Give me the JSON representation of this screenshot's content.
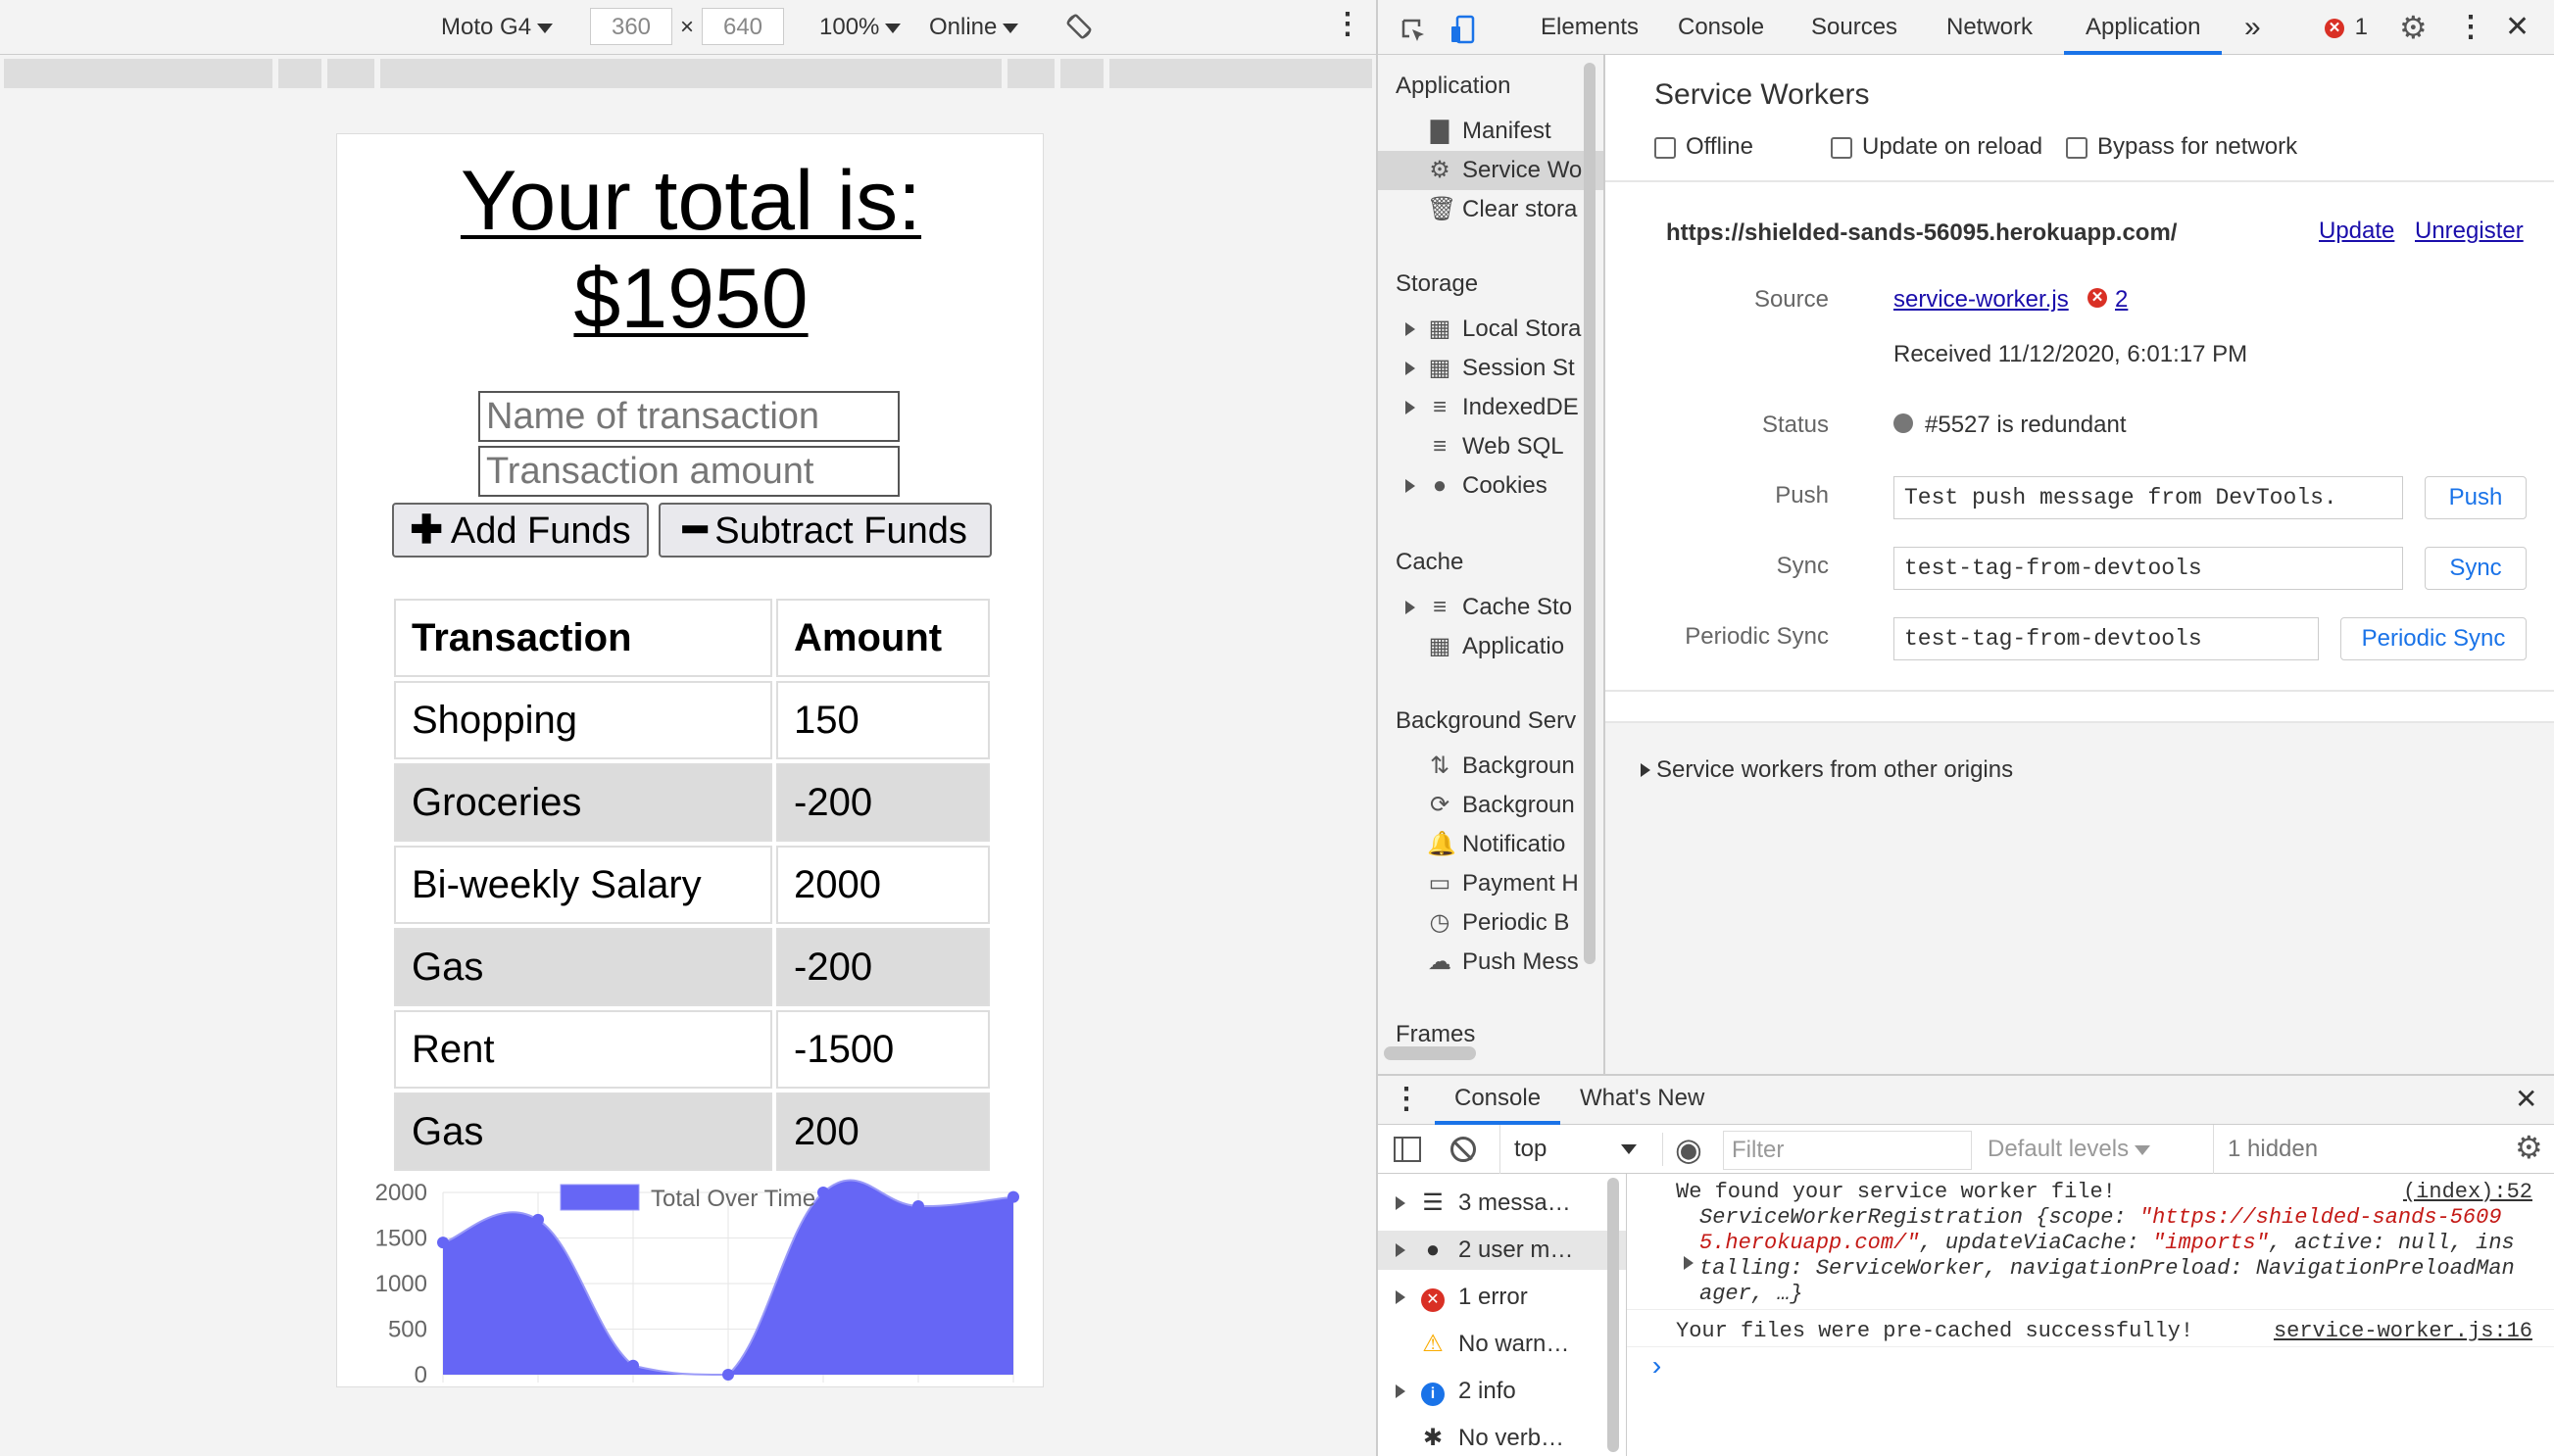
{
  "device_toolbar": {
    "device": "Moto G4",
    "width": "360",
    "height": "640",
    "times": "×",
    "zoom": "100%",
    "network": "Online"
  },
  "app": {
    "total_line1": "Your total is:",
    "total_line2": "$1950",
    "name_placeholder": "Name of transaction",
    "amount_placeholder": "Transaction amount",
    "add_label": "Add Funds",
    "subtract_label": "Subtract Funds",
    "table_headers": [
      "Transaction",
      "Amount"
    ],
    "rows": [
      {
        "name": "Shopping",
        "amount": "150"
      },
      {
        "name": "Groceries",
        "amount": "-200"
      },
      {
        "name": "Bi-weekly Salary",
        "amount": "2000"
      },
      {
        "name": "Gas",
        "amount": "-200"
      },
      {
        "name": "Rent",
        "amount": "-1500"
      },
      {
        "name": "Gas",
        "amount": "200"
      }
    ]
  },
  "chart_data": {
    "type": "area",
    "title": "",
    "series": [
      {
        "name": "Total Over Time",
        "values": [
          1450,
          1700,
          100,
          0,
          2000,
          1850,
          1950
        ],
        "color": "#6666f5"
      }
    ],
    "ylim": [
      0,
      2000
    ],
    "yticks": [
      "2000",
      "1500",
      "1000",
      "500",
      "0"
    ],
    "grid": true,
    "legend": "top"
  },
  "devtools": {
    "tabs": [
      "Elements",
      "Console",
      "Sources",
      "Network",
      "Application"
    ],
    "active_tab": "Application",
    "more": "»",
    "error_count": "1",
    "sidebar": {
      "application_header": "Application",
      "application_items": [
        "Manifest",
        "Service Wo",
        "Clear stora"
      ],
      "storage_header": "Storage",
      "storage_items": [
        "Local Stora",
        "Session St",
        "IndexedDE",
        "Web SQL",
        "Cookies"
      ],
      "cache_header": "Cache",
      "cache_items": [
        "Cache Sto",
        "Applicatio"
      ],
      "bg_header": "Background Serv",
      "bg_items": [
        "Backgroun",
        "Backgroun",
        "Notificatio",
        "Payment H",
        "Periodic B",
        "Push Mess"
      ],
      "frames_header": "Frames"
    },
    "sw": {
      "title": "Service Workers",
      "offline": "Offline",
      "update_on_reload": "Update on reload",
      "bypass": "Bypass for network",
      "url": "https://shielded-sands-56095.herokuapp.com/",
      "update": "Update",
      "unregister": "Unregister",
      "source_label": "Source",
      "source_file": "service-worker.js",
      "source_errors": "2",
      "received": "Received 11/12/2020, 6:01:17 PM",
      "status_label": "Status",
      "status": "#5527 is redundant",
      "push_label": "Push",
      "push_value": "Test push message from DevTools.",
      "push_btn": "Push",
      "sync_label": "Sync",
      "sync_value": "test-tag-from-devtools",
      "sync_btn": "Sync",
      "psync_label": "Periodic Sync",
      "psync_value": "test-tag-from-devtools",
      "psync_btn": "Periodic Sync",
      "other_origins": "Service workers from other origins"
    },
    "console": {
      "tabs": [
        "Console",
        "What's New"
      ],
      "context": "top",
      "filter_placeholder": "Filter",
      "levels": "Default levels",
      "hidden": "1 hidden",
      "side_items": [
        "3 messa…",
        "2 user m…",
        "1 error",
        "No warn…",
        "2 info",
        "No verb…"
      ],
      "log1_text": "We found your service worker file!",
      "log1_src": "(index):52",
      "log2_a": "ServiceWorkerRegistration {scope: ",
      "log2_scope": "\"https://shielded-sands-5609",
      "log2_scope2": "5.herokuapp.com/\"",
      "log2_b": ", updateViaCache: ",
      "log2_imports": "\"imports\"",
      "log2_c": ", active: null, ins",
      "log2_d": "talling: ServiceWorker, navigationPreload: NavigationPreloadMan",
      "log2_e": "ager, …}",
      "log3_text": "Your files were pre-cached successfully!",
      "log3_src": "service-worker.js:16",
      "prompt": "›"
    }
  }
}
